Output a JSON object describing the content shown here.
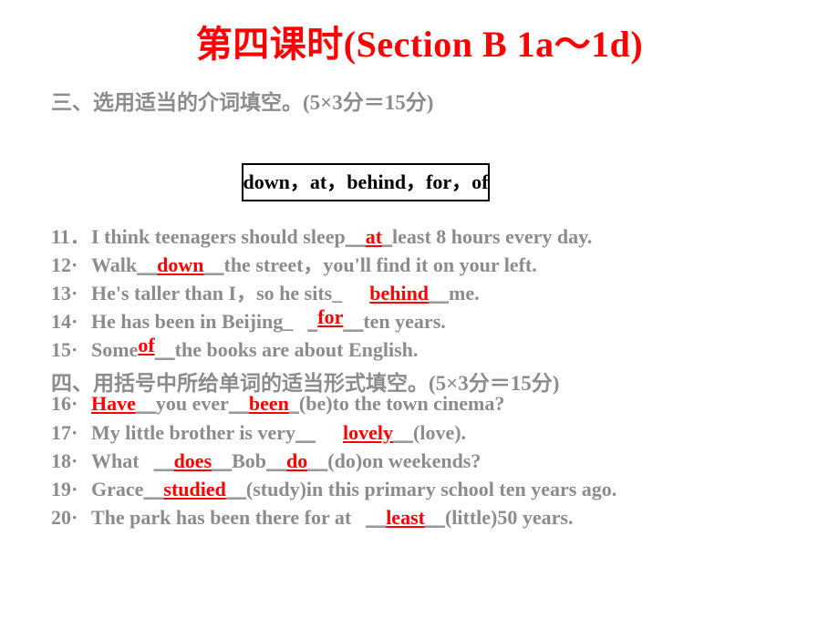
{
  "slide": {
    "title": "第四课时(Section B 1a～1d)",
    "title_color": "#FF0000",
    "background_color": "#FFFFFF",
    "body_color": "#8C8C8C",
    "answer_color": "#FF0000"
  },
  "section3": {
    "heading": "三、选用适当的介词填空。",
    "score": "(5×3分＝15分)",
    "word_bank": "down，at，behind，for，of"
  },
  "section4": {
    "heading": "四、用括号中所给单词的适当形式填空。",
    "score": "(5×3分＝15分)"
  },
  "questions": [
    {
      "num": "11．",
      "pre": "I think teenagers should sleep",
      "blank_before": "__",
      "answer": "at",
      "blank_after": "_",
      "post": "least 8 hours every day."
    },
    {
      "num": "12·",
      "pre": "Walk",
      "blank_before": "__",
      "answer": "down",
      "blank_after": "__",
      "post": "the street，you'll find it on your left."
    },
    {
      "num": "13·",
      "pre": "He's taller than I，so he sits_",
      "blank_before": "",
      "answer": "behind",
      "blank_after": "__",
      "post": "me."
    },
    {
      "num": "14·",
      "pre": "He has been in Beijing_",
      "blank_before": "_",
      "answer": "for",
      "blank_after": "__",
      "post": "ten years."
    },
    {
      "num": "15·",
      "pre": "Some",
      "blank_before": "",
      "answer": "of",
      "blank_after": "__",
      "post": "the books are about English."
    },
    {
      "num": "16·",
      "pre": "",
      "blank_before": "",
      "answer": "Have",
      "blank_after": "__",
      "mid": "you ever",
      "blank_before2": "__",
      "answer2": "been",
      "blank_after2": "_",
      "post": "(be)to the town cinema?"
    },
    {
      "num": "17·",
      "pre": "My little brother is very",
      "blank_before": "__",
      "answer": "lovely",
      "blank_after": "__",
      "post": "(love)."
    },
    {
      "num": "18·",
      "pre": "What",
      "blank_before": "__",
      "answer": "does",
      "blank_after": "__",
      "mid": "Bob",
      "blank_before2": "__",
      "answer2": "do",
      "blank_after2": "__",
      "post": "(do)on weekends?"
    },
    {
      "num": "19·",
      "pre": "Grace",
      "blank_before": "__",
      "answer": "studied",
      "blank_after": "__",
      "post": "(study)in this primary school ten years ago."
    },
    {
      "num": "20·",
      "pre": "The park has been there for at",
      "blank_before": "__",
      "answer": "least",
      "blank_after": "__",
      "post": "(little)50 years."
    }
  ]
}
